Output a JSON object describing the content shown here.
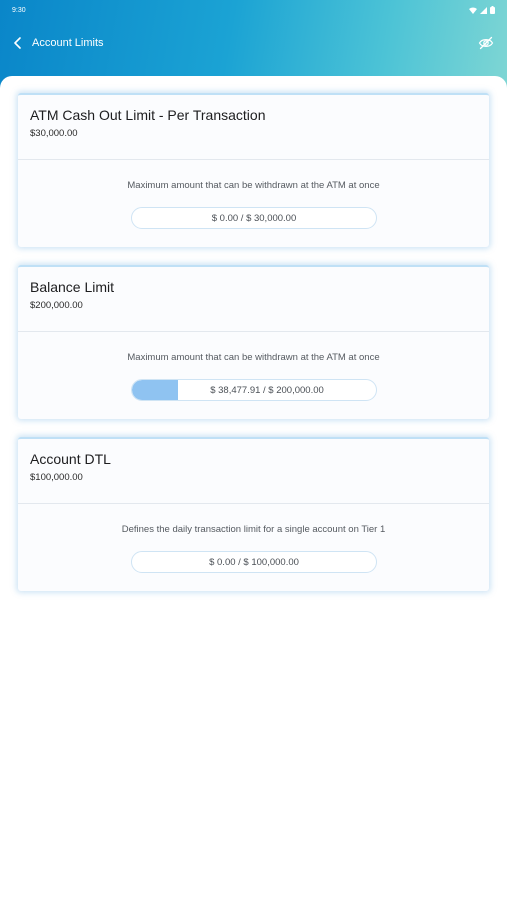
{
  "status_bar": {
    "time": "9:30"
  },
  "header": {
    "title": "Account Limits",
    "back_icon": "chevron-left-icon",
    "visibility_icon": "eye-off-icon"
  },
  "colors": {
    "header_start": "#0a86c9",
    "header_end": "#7fd6d4",
    "progress_fill": "#8fc3f1"
  },
  "cards": [
    {
      "title": "ATM Cash Out Limit - Per Transaction",
      "amount": "$30,000.00",
      "description": "Maximum amount that can be withdrawn at the ATM at once",
      "progress_text": "$ 0.00 / $ 30,000.00",
      "progress_fraction": 0.0
    },
    {
      "title": "Balance Limit",
      "amount": "$200,000.00",
      "description": "Maximum amount that can be withdrawn at the ATM at once",
      "progress_text": "$ 38,477.91 / $ 200,000.00",
      "progress_fraction": 0.19
    },
    {
      "title": "Account DTL",
      "amount": "$100,000.00",
      "description": "Defines the daily transaction limit for a single  account on Tier 1",
      "progress_text": "$ 0.00 / $ 100,000.00",
      "progress_fraction": 0.0
    }
  ]
}
